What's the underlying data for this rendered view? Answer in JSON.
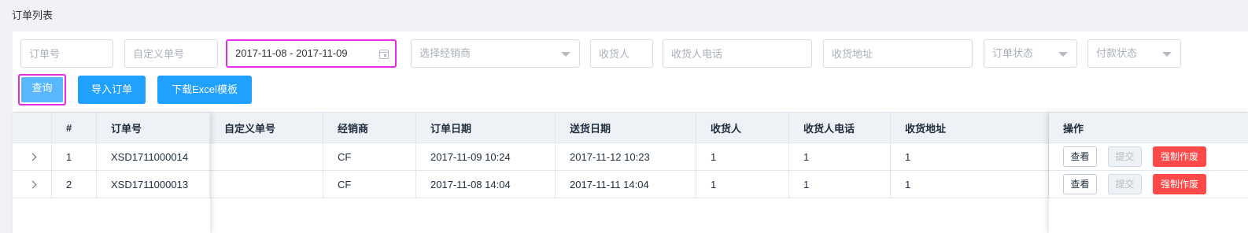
{
  "page": {
    "title": "订单列表"
  },
  "filters": {
    "order_no_placeholder": "订单号",
    "custom_no_placeholder": "自定义单号",
    "date_range_value": "2017-11-08 - 2017-11-09",
    "dealer_placeholder": "选择经销商",
    "receiver_placeholder": "收货人",
    "receiver_phone_placeholder": "收货人电话",
    "receiver_address_placeholder": "收货地址",
    "order_status_placeholder": "订单状态",
    "payment_status_placeholder": "付款状态"
  },
  "actions": {
    "query_label": "查询",
    "import_label": "导入订单",
    "download_template_label": "下载Excel模板"
  },
  "table": {
    "headers": {
      "index": "#",
      "order_no": "订单号",
      "custom_no": "自定义单号",
      "dealer": "经销商",
      "order_date": "订单日期",
      "delivery_date": "送货日期",
      "receiver": "收货人",
      "receiver_phone": "收货人电话",
      "receiver_address": "收货地址",
      "operations": "操作"
    },
    "rows": [
      {
        "index": "1",
        "order_no": "XSD1711000014",
        "custom_no": "",
        "dealer": "CF",
        "order_date": "2017-11-09 10:24",
        "delivery_date": "2017-11-12 10:23",
        "receiver": "1",
        "receiver_phone": "1",
        "receiver_address": "1"
      },
      {
        "index": "2",
        "order_no": "XSD1711000013",
        "custom_no": "",
        "dealer": "CF",
        "order_date": "2017-11-08 14:04",
        "delivery_date": "2017-11-11 14:04",
        "receiver": "1",
        "receiver_phone": "1",
        "receiver_address": "1"
      }
    ],
    "row_actions": {
      "view_label": "查看",
      "submit_label": "提交",
      "force_void_label": "强制作废"
    }
  },
  "colors": {
    "primary": "#20a0ff",
    "highlight": "#e92be3",
    "danger": "#ff4949",
    "header_bg": "#eef1f6",
    "page_bg": "#f0f2f5"
  },
  "icons": {
    "date_picker": "calendar-icon",
    "select": "chevron-down-icon",
    "row_expand": "chevron-right-icon"
  }
}
